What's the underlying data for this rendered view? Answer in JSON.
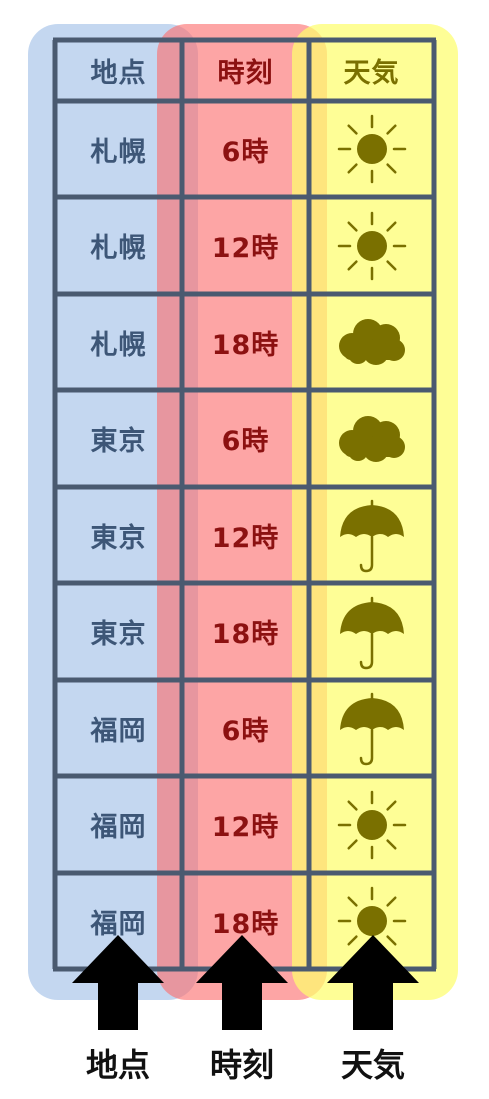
{
  "headers": {
    "location": "地点",
    "time": "時刻",
    "weather": "天気"
  },
  "rows": [
    {
      "location": "札幌",
      "time": "6時",
      "weather": "sun-icon"
    },
    {
      "location": "札幌",
      "time": "12時",
      "weather": "sun-icon"
    },
    {
      "location": "札幌",
      "time": "18時",
      "weather": "cloud-icon"
    },
    {
      "location": "東京",
      "time": "6時",
      "weather": "cloud-icon"
    },
    {
      "location": "東京",
      "time": "12時",
      "weather": "umbrella-icon"
    },
    {
      "location": "東京",
      "time": "18時",
      "weather": "umbrella-icon"
    },
    {
      "location": "福岡",
      "time": "6時",
      "weather": "umbrella-icon"
    },
    {
      "location": "福岡",
      "time": "12時",
      "weather": "sun-icon"
    },
    {
      "location": "福岡",
      "time": "18時",
      "weather": "sun-icon"
    }
  ],
  "labels": {
    "location": "地点",
    "time": "時刻",
    "weather": "天気"
  },
  "colors": {
    "location_band": "#94b6e4",
    "time_band": "#fc6e6e",
    "weather_band": "#fdfd6e",
    "location_text": "#3d5677",
    "time_text": "#8c1111",
    "weather_text": "#7a7000",
    "grid": "#4a5a70",
    "icon": "#7a7000"
  }
}
